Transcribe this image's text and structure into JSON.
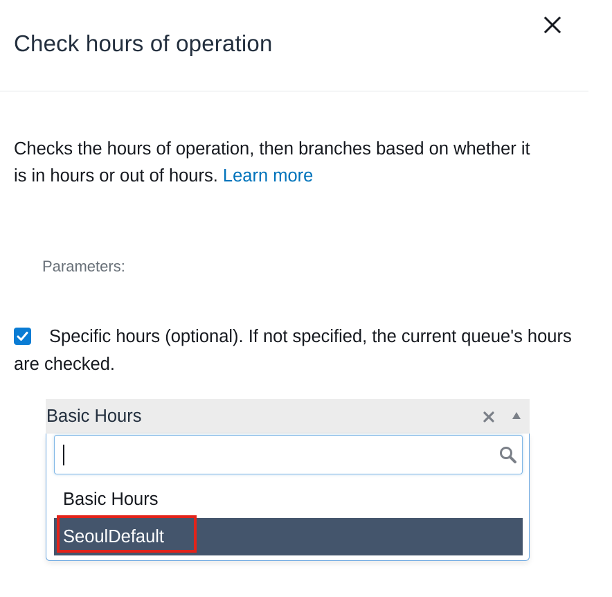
{
  "panel": {
    "title": "Check hours of operation",
    "close_icon": "close-icon"
  },
  "description": {
    "text": "Checks the hours of operation, then branches based on whether it is in hours or out of hours.",
    "learn_more": "Learn more"
  },
  "parameters": {
    "label": "Parameters:",
    "specific_hours": {
      "checked": true,
      "label": "Specific hours (optional). If not specified, the current queue's hours are checked."
    }
  },
  "hours_select": {
    "selected_value": "Basic Hours",
    "clear_icon": "clear-x-icon",
    "arrow_icon": "caret-up-icon",
    "search": {
      "value": "",
      "placeholder": "",
      "icon": "search-icon"
    },
    "options": [
      {
        "label": "Basic Hours",
        "highlighted": false
      },
      {
        "label": "SeoulDefault",
        "highlighted": true
      }
    ]
  },
  "colors": {
    "link": "#0073bb",
    "checkbox": "#0a7cd4",
    "option_highlight_bg": "#44556c",
    "annotation_box": "#e2231a",
    "select_bg": "#ececec"
  }
}
